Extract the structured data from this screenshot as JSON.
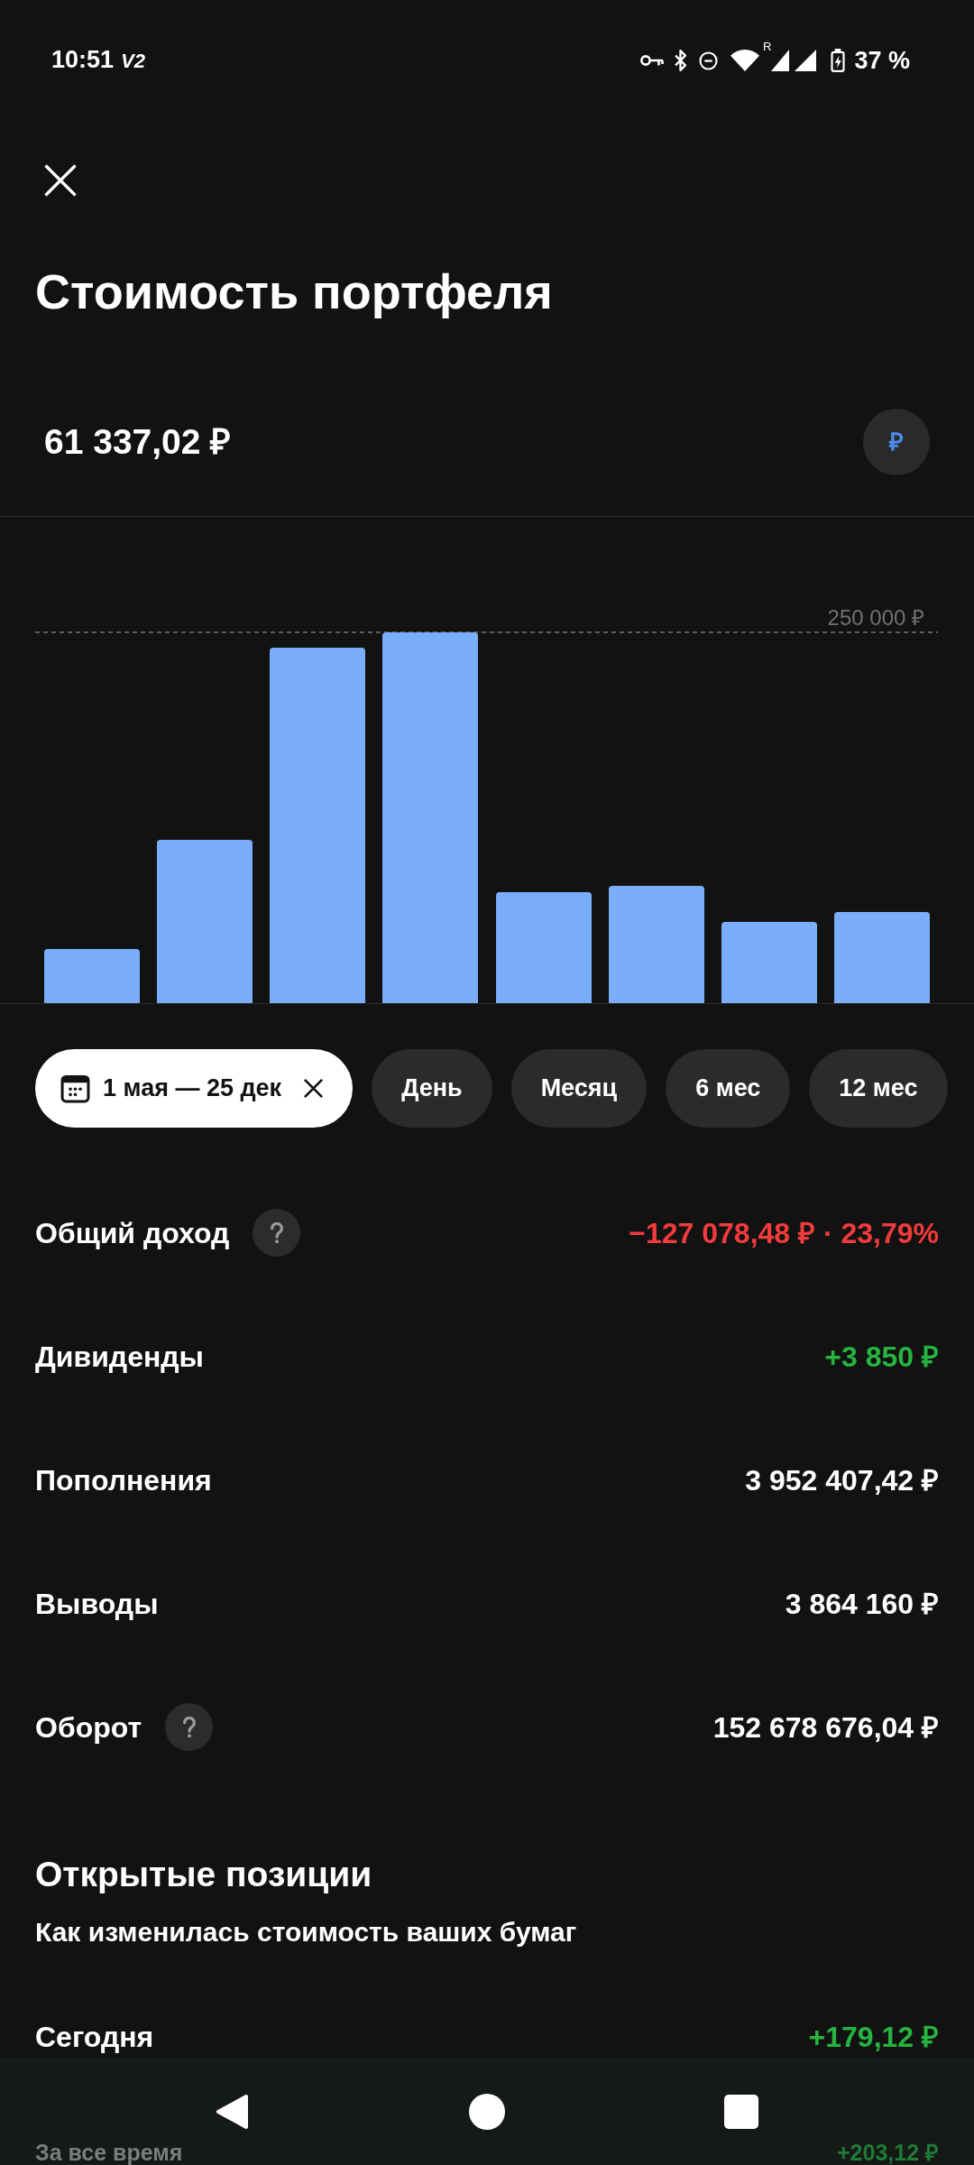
{
  "status_bar": {
    "time": "10:51",
    "network_label": "V2",
    "roaming_label": "R",
    "battery": "37 %"
  },
  "header": {
    "title": "Стоимость портфеля"
  },
  "portfolio": {
    "value": "61 337,02 ₽",
    "currency_symbol": "₽"
  },
  "chart": {
    "reference_label": "250 000 ₽"
  },
  "period_filters": [
    {
      "label": "1 мая — 25 дек",
      "kind": "date_range",
      "selected": true
    },
    {
      "label": "День",
      "kind": "period",
      "selected": false
    },
    {
      "label": "Месяц",
      "kind": "period",
      "selected": false
    },
    {
      "label": "6 мес",
      "kind": "period",
      "selected": false
    },
    {
      "label": "12 мес",
      "kind": "period",
      "selected": false
    }
  ],
  "summary": [
    {
      "label": "Общий доход",
      "has_help": true,
      "value": "−127 078,48 ₽ · 23,79%",
      "color": "#f23b3b"
    },
    {
      "label": "Дивиденды",
      "has_help": false,
      "value": "+3 850 ₽",
      "color": "#27b33f"
    },
    {
      "label": "Пополнения",
      "has_help": false,
      "value": "3 952 407,42 ₽",
      "color": "#ffffff"
    },
    {
      "label": "Выводы",
      "has_help": false,
      "value": "3 864 160 ₽",
      "color": "#ffffff"
    },
    {
      "label": "Оборот",
      "has_help": true,
      "value": "152 678 676,04 ₽",
      "color": "#ffffff"
    }
  ],
  "positions": {
    "title": "Открытые позиции",
    "subtitle": "Как изменилась стоимость ваших бумаг",
    "rows": [
      {
        "label": "Сегодня",
        "value": "+179,12 ₽",
        "color": "#27b33f",
        "dimmed": false
      },
      {
        "label": "За все время",
        "value": "+203,12 ₽",
        "color": "#1f7a36",
        "dimmed": true
      }
    ]
  }
}
